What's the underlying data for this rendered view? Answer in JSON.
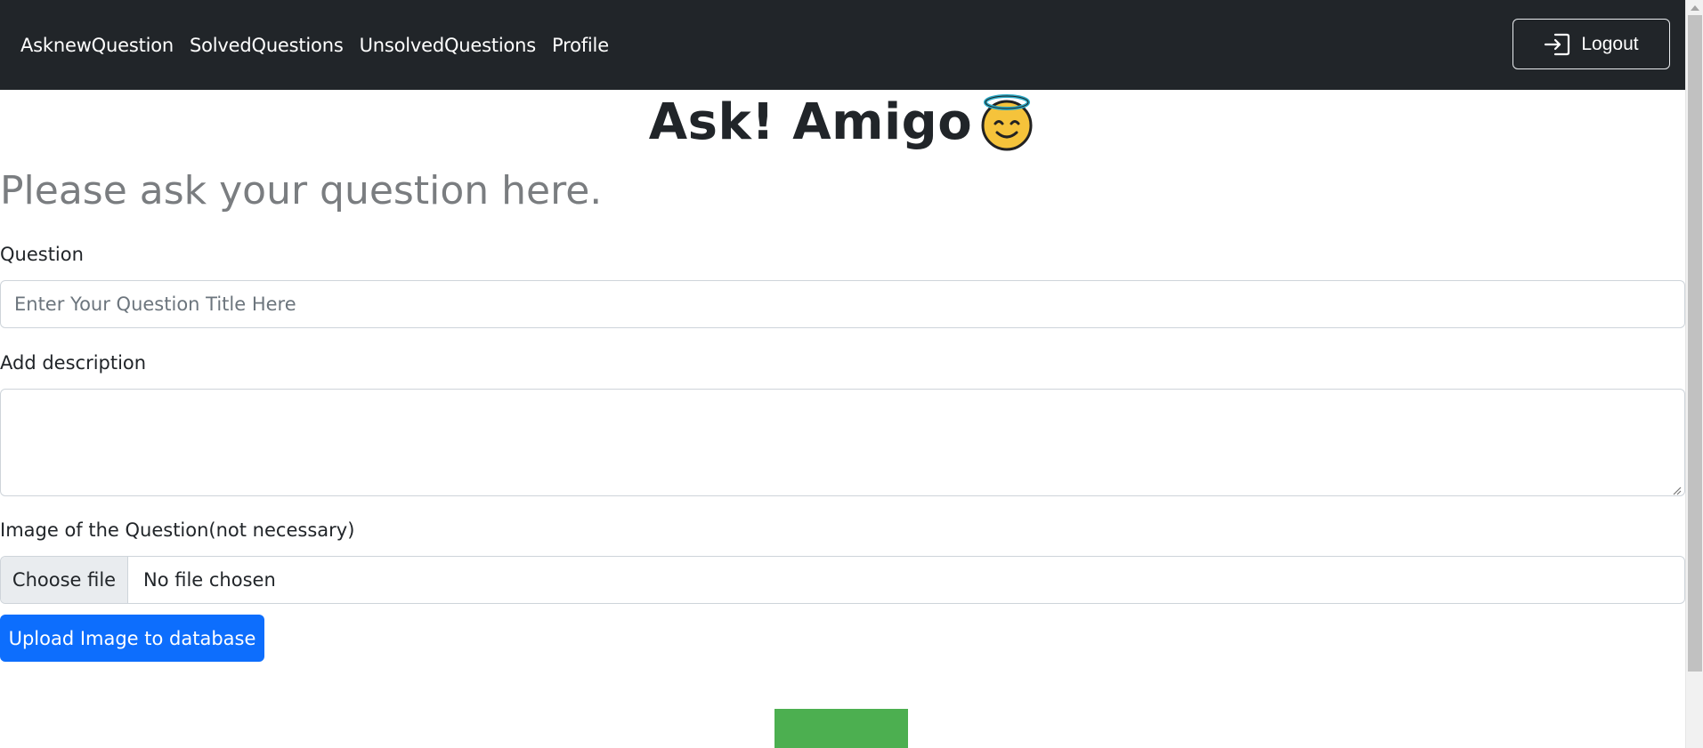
{
  "navbar": {
    "links": [
      {
        "label": "AsknewQuestion"
      },
      {
        "label": "SolvedQuestions"
      },
      {
        "label": "UnsolvedQuestions"
      },
      {
        "label": "Profile"
      }
    ],
    "logout_label": "Logout",
    "logout_icon": "box-arrow-in-right-icon",
    "background": "#212529"
  },
  "header": {
    "title": "Ask! Amigo",
    "emoji_icon": "smiling-face-with-halo-icon"
  },
  "form": {
    "intro": "Please ask your question here.",
    "question_label": "Question",
    "question_placeholder": "Enter Your Question Title Here",
    "question_value": "",
    "description_label": "Add description",
    "description_value": "",
    "image_label": "Image of the Question(not necessary)",
    "file_button_label": "Choose file",
    "file_status": "No file chosen",
    "upload_button_label": "Upload Image to database"
  },
  "colors": {
    "primary": "#0d6efd",
    "green": "#4caf50",
    "muted": "#7a7d80"
  }
}
